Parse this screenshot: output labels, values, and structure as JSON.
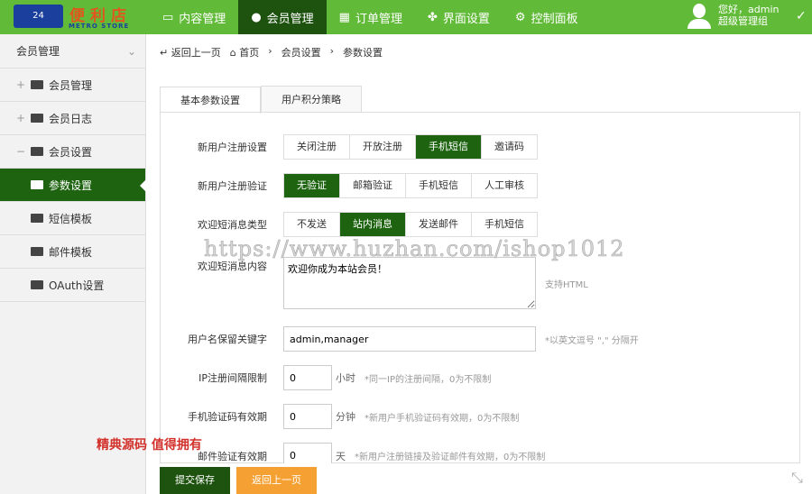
{
  "logo": {
    "badge": "24",
    "name": "便利店",
    "sub": "METRO STORE"
  },
  "nav": [
    {
      "label": "内容管理",
      "icon": "monitor-icon"
    },
    {
      "label": "会员管理",
      "icon": "user-icon",
      "active": true
    },
    {
      "label": "订单管理",
      "icon": "order-icon"
    },
    {
      "label": "界面设置",
      "icon": "puzzle-icon"
    },
    {
      "label": "控制面板",
      "icon": "gear-icon"
    }
  ],
  "user": {
    "greeting": "您好，admin",
    "group": "超级管理组"
  },
  "sidebar": {
    "title": "会员管理",
    "items": [
      {
        "label": "会员管理",
        "prefix": "+"
      },
      {
        "label": "会员日志",
        "prefix": "+"
      },
      {
        "label": "会员设置",
        "prefix": "−"
      },
      {
        "label": "参数设置",
        "active": true
      },
      {
        "label": "短信模板"
      },
      {
        "label": "邮件模板"
      },
      {
        "label": "OAuth设置"
      }
    ]
  },
  "breadcrumb": {
    "back": "返回上一页",
    "home": "首页",
    "level1": "会员设置",
    "current": "参数设置"
  },
  "tabs": [
    "基本参数设置",
    "用户积分策略"
  ],
  "form": {
    "reg": {
      "label": "新用户注册设置",
      "options": [
        "关闭注册",
        "开放注册",
        "手机短信",
        "邀请码"
      ],
      "selected": 2
    },
    "verify": {
      "label": "新用户注册验证",
      "options": [
        "无验证",
        "邮箱验证",
        "手机短信",
        "人工审核"
      ],
      "selected": 0
    },
    "welcome_type": {
      "label": "欢迎短消息类型",
      "options": [
        "不发送",
        "站内消息",
        "发送邮件",
        "手机短信"
      ],
      "selected": 1
    },
    "welcome_content": {
      "label": "欢迎短消息内容",
      "value": "欢迎你成为本站会员！",
      "hint": "支持HTML"
    },
    "reserved": {
      "label": "用户名保留关键字",
      "value": "admin,manager",
      "hint": "*以英文逗号 \",\" 分隔开"
    },
    "ip_limit": {
      "label": "IP注册间隔限制",
      "value": "0",
      "unit": "小时",
      "hint": "*同一IP的注册间隔，0为不限制"
    },
    "sms_expire": {
      "label": "手机验证码有效期",
      "value": "0",
      "unit": "分钟",
      "hint": "*新用户手机验证码有效期，0为不限制"
    },
    "mail_expire": {
      "label": "邮件验证有效期",
      "value": "0",
      "unit": "天",
      "hint": "*新用户注册链接及验证邮件有效期，0为不限制"
    }
  },
  "buttons": {
    "save": "提交保存",
    "back": "返回上一页"
  },
  "watermarks": {
    "url": "https://www.huzhan.com/ishop1012",
    "slogan": "精典源码  值得拥有"
  },
  "colors": {
    "header": "#62bb38",
    "active": "#1e6410",
    "orange": "#f5a033"
  }
}
